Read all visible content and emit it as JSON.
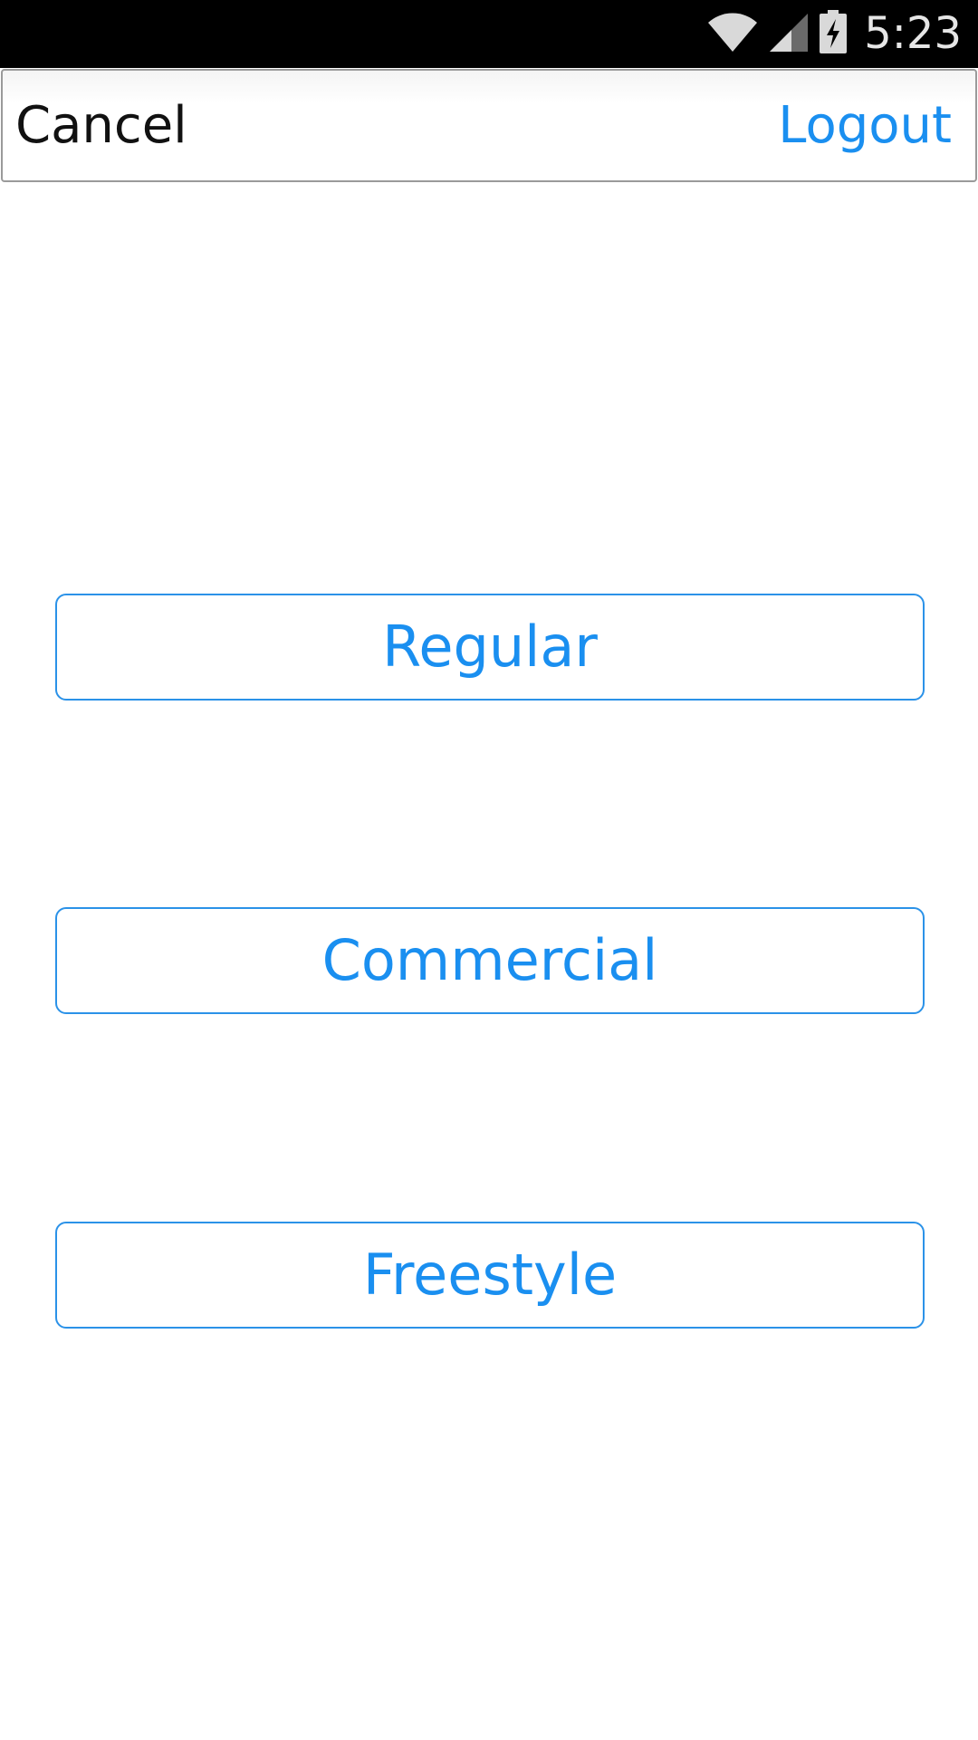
{
  "status_bar": {
    "time": "5:23",
    "icons": [
      "wifi-icon",
      "signal-icon",
      "battery-charging-icon"
    ],
    "background": "#000000"
  },
  "nav_bar": {
    "cancel_label": "Cancel",
    "logout_label": "Logout",
    "accent_color": "#1a8ff0"
  },
  "options": [
    {
      "label": "Regular"
    },
    {
      "label": "Commercial"
    },
    {
      "label": "Freestyle"
    }
  ]
}
